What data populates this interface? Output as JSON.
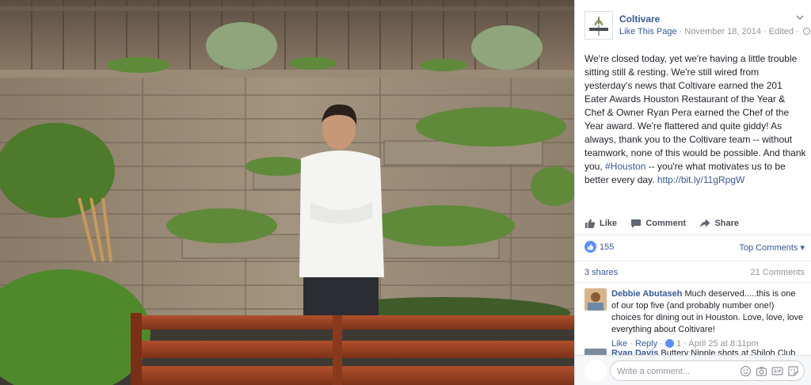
{
  "page": {
    "name": "Coltivare",
    "like_this_page": "Like This Page",
    "date": "November 18, 2014",
    "edited": "Edited"
  },
  "post": {
    "text_before_tag": "We're closed today, yet we're having a little trouble sitting still & resting. We're still wired from yesterday's news that Coltivare earned the 201 Eater Awards Houston Restaurant of the Year & Chef & Owner Ryan Pera earned the Chef of the Year award. We're flattered and quite giddy! As always, thank you to the Coltivare team -- without teamwork, none of this would be possible. And thank you, ",
    "hashtag": "#Houston",
    "text_after_tag": " -- you're what motivates us to be better every day. ",
    "link": "http://bit.ly/11gRpgW"
  },
  "actions": {
    "like": "Like",
    "comment": "Comment",
    "share": "Share"
  },
  "stats": {
    "reactions": "155",
    "top_comments": "Top Comments",
    "shares": "3 shares",
    "comments": "21 Comments"
  },
  "comments": [
    {
      "name": "Debbie Abutaseh",
      "text": "Much deserved.....this is one of our top five (and probably number one!) choices for dining out in Houston. Love, love, love everything about Coltivare!",
      "like": "Like",
      "reply": "Reply",
      "likes": "1",
      "time": "April 25 at 8:11pm"
    },
    {
      "name": "Ryan Davis",
      "text": "Buttery Nipple shots at Shiloh Club"
    }
  ],
  "composer": {
    "placeholder": "Write a comment..."
  },
  "icons": {
    "like": "thumbs-up-icon",
    "comment": "speech-bubble-icon",
    "share": "share-arrow-icon",
    "composer": [
      "emoji-icon",
      "camera-icon",
      "gif-icon",
      "sticker-icon"
    ]
  },
  "colors": {
    "link": "#365899",
    "like_blue": "#5890ff",
    "muted": "#90949c"
  }
}
